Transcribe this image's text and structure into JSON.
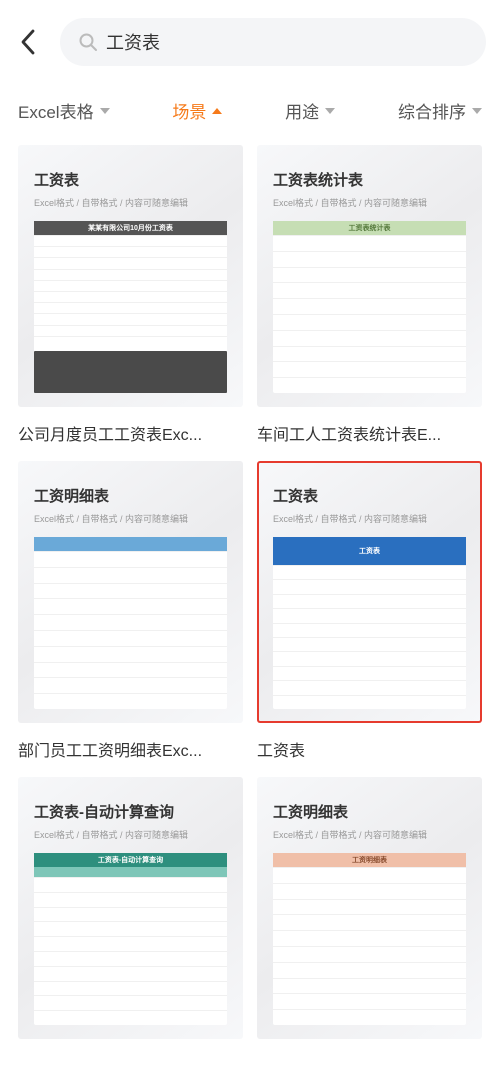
{
  "search": {
    "value": "工资表"
  },
  "filters": {
    "format": "Excel表格",
    "scene": "场景",
    "use": "用途",
    "sort": "综合排序"
  },
  "thumb_meta": "Excel格式 / 自带格式 / 内容可随意编辑",
  "cards": [
    {
      "title": "工资表",
      "header_text": "某某有限公司10月份工资表",
      "caption": "公司月度员工工资表Exc...",
      "has_chart": true,
      "cls": "c1"
    },
    {
      "title": "工资表统计表",
      "header_text": "工资表统计表",
      "caption": "车间工人工资表统计表E...",
      "has_chart": false,
      "cls": "c2"
    },
    {
      "title": "工资明细表",
      "header_text": "",
      "caption": "部门员工工资明细表Exc...",
      "has_chart": false,
      "cls": "c3"
    },
    {
      "title": "工资表",
      "header_text": "工资表",
      "caption": "工资表",
      "has_chart": false,
      "cls": "c4",
      "selected": true
    },
    {
      "title": "工资表-自动计算查询",
      "header_text": "工资表-自动计算查询",
      "caption": "",
      "has_chart": false,
      "cls": "c5",
      "two_header": true
    },
    {
      "title": "工资明细表",
      "header_text": "工资明细表",
      "caption": "",
      "has_chart": false,
      "cls": "c6"
    }
  ]
}
